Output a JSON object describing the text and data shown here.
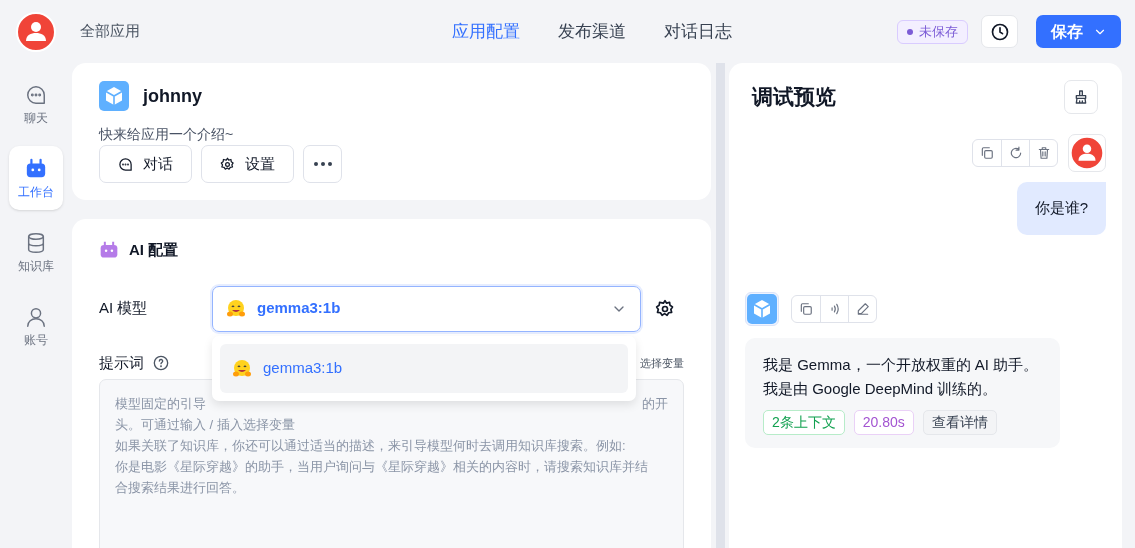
{
  "sidebar": {
    "items": [
      {
        "label": "聊天",
        "selected": false
      },
      {
        "label": "工作台",
        "selected": true
      },
      {
        "label": "知识库",
        "selected": false
      },
      {
        "label": "账号",
        "selected": false
      }
    ]
  },
  "header": {
    "breadcrumb": "全部应用",
    "tabs": [
      {
        "label": "应用配置",
        "selected": true
      },
      {
        "label": "发布渠道",
        "selected": false
      },
      {
        "label": "对话日志",
        "selected": false
      }
    ],
    "status_badge": "未保存",
    "save_button": "保存"
  },
  "app_card": {
    "name": "johnny",
    "intro": "快来给应用一个介绍~",
    "buttons": [
      "对话",
      "设置"
    ]
  },
  "ai_config": {
    "title": "AI 配置",
    "model_label": "AI 模型",
    "model_value": "gemma3:1b",
    "prompt_label": "提示词",
    "prompt_action": "选择变量",
    "prompt_placeholder_lines": [
      {
        "left": "模型固定的引导",
        "right": "的开"
      },
      {
        "left": "头。可通过输入 / 插入选择变量"
      },
      {
        "left": "如果关联了知识库，你还可以通过适当的描述，来引导模型何时去调用知识库搜索。例如:"
      },
      {
        "left": "你是电影《星际穿越》的助手，当用户询问与《星际穿越》相关的内容时，请搜索知识库并结"
      },
      {
        "left": "合搜索结果进行回答。"
      }
    ],
    "dropdown": {
      "expanded": true,
      "options": [
        {
          "label": "gemma3:1b",
          "selected": true
        }
      ]
    }
  },
  "preview": {
    "title": "调试预览",
    "messages": [
      {
        "kind": "user",
        "text": "你是谁?"
      },
      {
        "kind": "assistant",
        "text": "我是 Gemma，一个开放权重的 AI 助手。我是由 Google DeepMind 训练的。",
        "tags": [
          {
            "label": "2条上下文",
            "kind": "context"
          },
          {
            "label": "20.80s",
            "kind": "time"
          },
          {
            "label": "查看详情",
            "kind": "detail"
          }
        ]
      }
    ]
  }
}
